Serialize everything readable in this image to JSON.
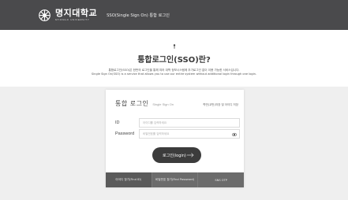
{
  "header": {
    "logo_kr": "명지대학교",
    "logo_en": "MYONGJI UNIVERSITY",
    "title": "SSO(Single Sign On) 통합 로그인"
  },
  "intro": {
    "title": "통합로그인(SSO)란?",
    "desc_kr": "통합로그인(SSO)은 한번의 로그인을 통해 여러 대학 정보시스템에 추가로그인 없이 이용 가능한 서비스입니다.",
    "desc_en": "Single Sign On(SSO) is a service that allows you to use our entire system without additional login through one login."
  },
  "login": {
    "title": "통합 로그인",
    "subtitle": "Single Sign On",
    "save_id_label": "학번(교번)저장 및 아이디 저장",
    "id_label": "ID",
    "id_placeholder": "아이디를 입력하세요",
    "pw_label": "Password",
    "pw_placeholder": "비밀번호를 입력하세요",
    "button_label": "로그인(login)"
  },
  "footer": {
    "links": [
      "아이디 찾기(Find ID)",
      "비밀번호 찾기(Find Password)",
      "SNS OTP"
    ]
  },
  "colors": {
    "header_bg": "#4a4a4c",
    "button_bg": "#3c3c3c",
    "footer_bg": "#6b6b6b"
  }
}
